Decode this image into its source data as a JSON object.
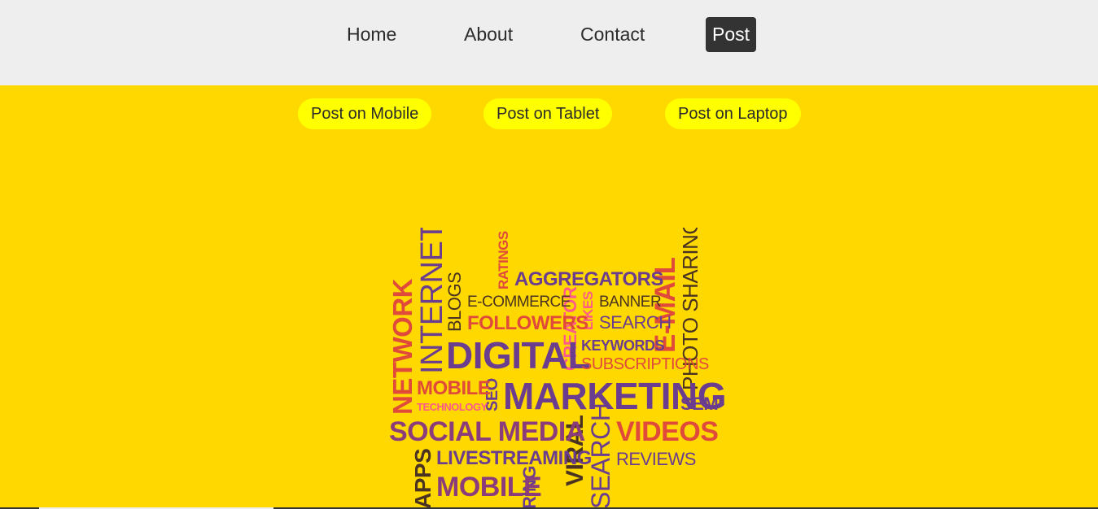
{
  "nav": {
    "home": "Home",
    "about": "About",
    "contact": "Contact",
    "post": "Post"
  },
  "subnav": {
    "mobile": "Post on Mobile",
    "tablet": "Post on Tablet",
    "laptop": "Post on Laptop"
  },
  "colors": {
    "page_bg": "#ffd800",
    "nav_bg": "#eeeeee",
    "active_bg": "#333333",
    "pill_bg": "#ffff00",
    "purple": "#6a3d8f",
    "red": "#e04a3a",
    "pink": "#ff5a8a",
    "dark": "#4a3320"
  },
  "wordcloud": {
    "network": "NETWORK",
    "internet": "INTERNET",
    "blogs": "BLOGS",
    "ratings": "RATINGS",
    "aggregators": "AGGREGATORS",
    "ecommerce": "E-COMMERCE",
    "banner": "BANNER",
    "followers": "FOLLOWERS",
    "creator": "CREATOR",
    "likes": "LIKES",
    "search_small": "SEARCH",
    "email": "E-MAIL",
    "photo_sharing": "PHOTO SHARING",
    "digital": "DIGITAL",
    "keywords": "KEYWORDS",
    "subscriptions": "SUBSCRIPTIONS",
    "mobile_small": "MOBILE",
    "technology": "TECHNOLOGY",
    "seo": "SEO",
    "marketing": "MARKETING",
    "sem": "SEM",
    "social_media": "SOCIAL MEDIA",
    "videos": "VIDEOS",
    "apps": "APPS",
    "livestreaming": "LIVESTREAMING",
    "viral": "VIRAL",
    "search_big": "SEARCH",
    "reviews": "REVIEWS",
    "mobile_big": "MOBILE",
    "ring": "RING"
  }
}
